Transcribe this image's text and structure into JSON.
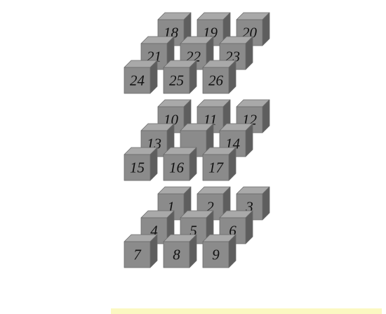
{
  "figure": {
    "colors": {
      "front_face": "#8b8b8b",
      "top_face": "#a9a9a9",
      "side_face": "#5e5e5e",
      "edge": "#6a6a6a",
      "label": "#111111",
      "bottom_strip": "#fbf8c2"
    },
    "layers": [
      {
        "rows": [
          {
            "cubes": [
              {
                "label": "18"
              },
              {
                "label": "19"
              },
              {
                "label": "20"
              }
            ]
          },
          {
            "cubes": [
              {
                "label": "21"
              },
              {
                "label": "22"
              },
              {
                "label": "23"
              }
            ]
          },
          {
            "cubes": [
              {
                "label": "24"
              },
              {
                "label": "25"
              },
              {
                "label": "26"
              }
            ]
          }
        ]
      },
      {
        "rows": [
          {
            "cubes": [
              {
                "label": "10"
              },
              {
                "label": "11"
              },
              {
                "label": "12"
              }
            ]
          },
          {
            "cubes": [
              {
                "label": "13"
              },
              {
                "label": ""
              },
              {
                "label": "14"
              }
            ]
          },
          {
            "cubes": [
              {
                "label": "15"
              },
              {
                "label": "16"
              },
              {
                "label": "17"
              }
            ]
          }
        ]
      },
      {
        "rows": [
          {
            "cubes": [
              {
                "label": "1"
              },
              {
                "label": "2"
              },
              {
                "label": "3"
              }
            ]
          },
          {
            "cubes": [
              {
                "label": "4"
              },
              {
                "label": "5"
              },
              {
                "label": "6"
              }
            ]
          },
          {
            "cubes": [
              {
                "label": "7"
              },
              {
                "label": "8"
              },
              {
                "label": "9"
              }
            ]
          }
        ]
      }
    ]
  }
}
